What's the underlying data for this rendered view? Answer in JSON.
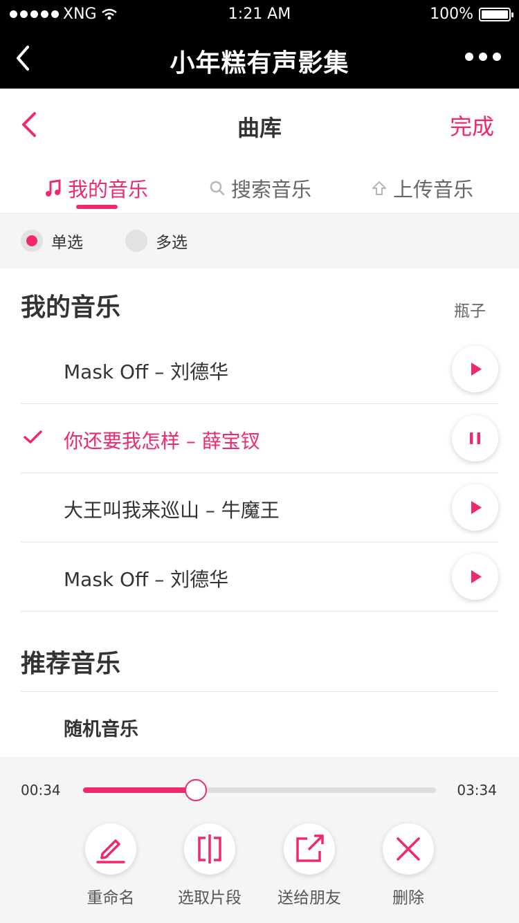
{
  "status_bar": {
    "carrier": "XNG",
    "time": "1:21 AM",
    "battery": "100%"
  },
  "navbar": {
    "title": "小年糕有声影集"
  },
  "library": {
    "title": "曲库",
    "done_label": "完成"
  },
  "tabs": [
    {
      "label": "我的音乐",
      "icon": "music-note-icon",
      "active": true
    },
    {
      "label": "搜索音乐",
      "icon": "search-icon",
      "active": false
    },
    {
      "label": "上传音乐",
      "icon": "upload-icon",
      "active": false
    }
  ],
  "select_mode": {
    "single": "单选",
    "multi": "多选",
    "selected": "单选"
  },
  "my_music": {
    "title": "我的音乐",
    "side_label": "瓶子",
    "songs": [
      {
        "label": "Mask Off – 刘德华",
        "selected": false,
        "state": "play"
      },
      {
        "label": "你还要我怎样 – 薛宝钗",
        "selected": true,
        "state": "pause"
      },
      {
        "label": "大王叫我来巡山 – 牛魔王",
        "selected": false,
        "state": "play"
      },
      {
        "label": "Mask Off – 刘德华",
        "selected": false,
        "state": "play"
      }
    ]
  },
  "recommended": {
    "title": "推荐音乐",
    "items": [
      {
        "label": "随机音乐"
      }
    ]
  },
  "player": {
    "current_time": "00:34",
    "total_time": "03:34",
    "progress": 0.32
  },
  "actions": [
    {
      "label": "重命名",
      "icon": "pencil-icon"
    },
    {
      "label": "选取片段",
      "icon": "clip-icon"
    },
    {
      "label": "送给朋友",
      "icon": "share-icon"
    },
    {
      "label": "删除",
      "icon": "close-icon"
    }
  ],
  "colors": {
    "accent": "#f0286e",
    "text": "#333333",
    "panel_bg": "#f5f5f5"
  }
}
